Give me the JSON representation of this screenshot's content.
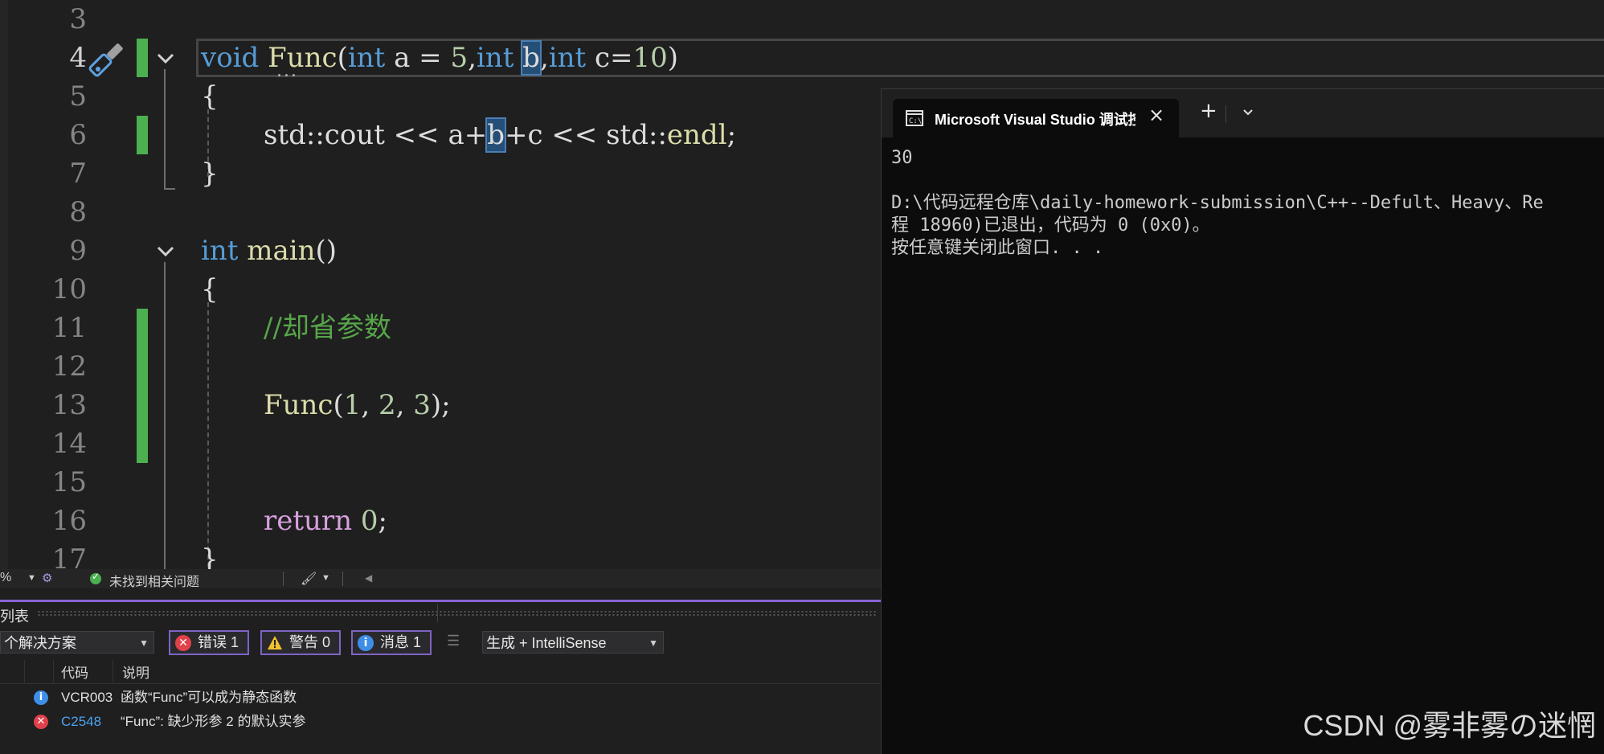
{
  "editor": {
    "lines": [
      {
        "num": "3"
      },
      {
        "num": "4",
        "seg": [
          "void",
          " ",
          "Func",
          "(",
          "int",
          " a = ",
          "5",
          ",",
          "int",
          " ",
          "b",
          ",",
          "int",
          " c=",
          "10",
          ")"
        ]
      },
      {
        "num": "5",
        "text": "{"
      },
      {
        "num": "6",
        "seg": [
          "std::cout << a+",
          "b",
          "+c << std::",
          "endl",
          ";"
        ]
      },
      {
        "num": "7",
        "text": "}"
      },
      {
        "num": "8"
      },
      {
        "num": "9",
        "seg": [
          "int",
          " ",
          "main",
          "()"
        ]
      },
      {
        "num": "10",
        "text": "{"
      },
      {
        "num": "11",
        "text": "//却省参数"
      },
      {
        "num": "12"
      },
      {
        "num": "13",
        "seg": [
          "Func",
          "(",
          "1",
          ", ",
          "2",
          ", ",
          "3",
          ");"
        ]
      },
      {
        "num": "14"
      },
      {
        "num": "15"
      },
      {
        "num": "16",
        "seg": [
          "return",
          " ",
          "0",
          ";"
        ]
      },
      {
        "num": "17",
        "text": "}"
      }
    ],
    "squiggle": "...",
    "icons": [
      "screwdriver-icon",
      "chevron-down-icon"
    ],
    "colors": {
      "keyword": "#569cd6",
      "function": "#dcdcaa",
      "number": "#b5cea8",
      "comment": "#57a64a",
      "return": "#d8a0df",
      "changed": "#4caf50"
    }
  },
  "status": {
    "zoom": "%",
    "issues": "未找到相关问题"
  },
  "error_list": {
    "title": "列表",
    "scope": "个解决方案",
    "errors_btn": "错误 1",
    "warnings_btn": "警告 0",
    "messages_btn": "消息 1",
    "build_filter": "生成 + IntelliSense",
    "col_code": "代码",
    "col_desc": "说明",
    "rows": [
      {
        "type": "info",
        "code": "VCR003",
        "desc": "函数“Func”可以成为静态函数"
      },
      {
        "type": "error",
        "code": "C2548",
        "desc": "“Func”: 缺少形参 2 的默认实参"
      }
    ],
    "colors": {
      "error": "#e0414b",
      "warning": "#f0c030",
      "info": "#3e8ee8",
      "filter_border": "#7e63c4"
    }
  },
  "console": {
    "tab_title": "Microsoft Visual Studio 调试控制台",
    "output": [
      "30",
      "",
      "D:\\代码远程仓库\\daily-homework-submission\\C++--Defult、Heavy、Re",
      "程 18960)已退出，代码为 0 (0x0)。",
      "按任意键关闭此窗口. . ."
    ]
  },
  "watermark": "CSDN @雾非雾の迷惘"
}
